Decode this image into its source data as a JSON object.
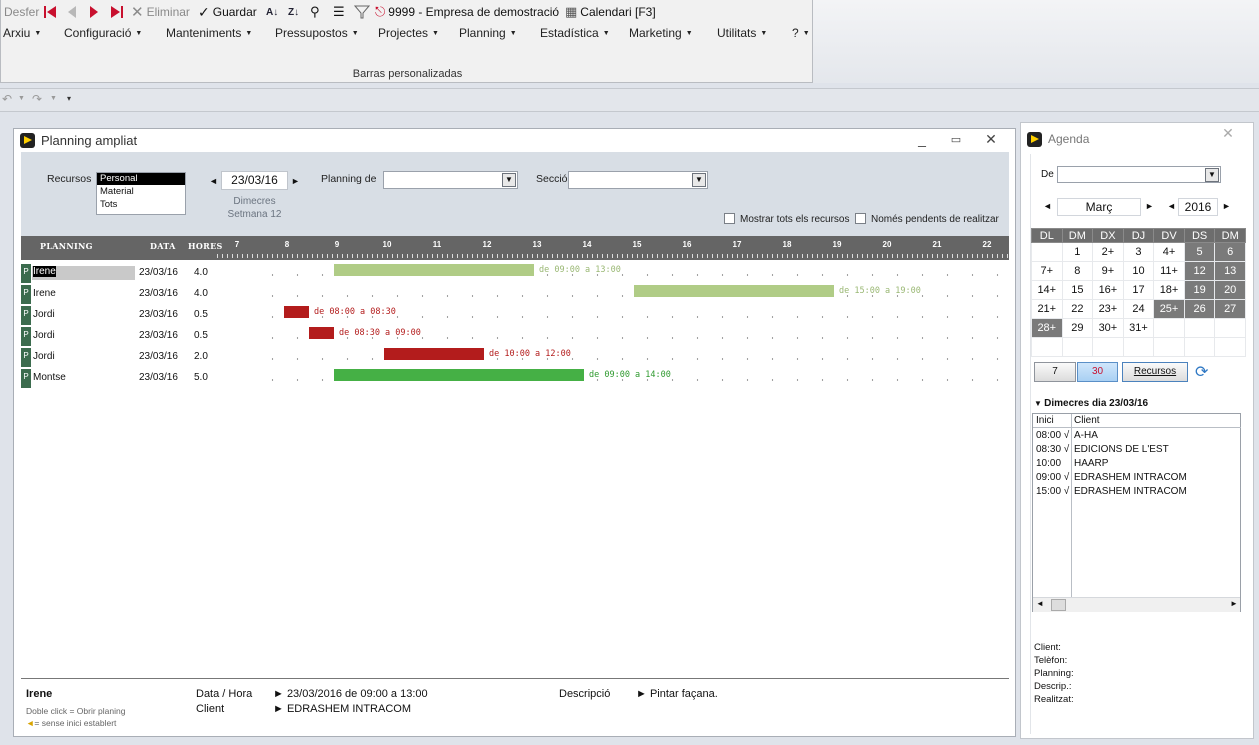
{
  "toolbar": {
    "undo": "Desfer",
    "delete": "Eliminar",
    "save": "Guardar",
    "company": "9999 - Empresa de demostració",
    "calendar": "Calendari [F3]"
  },
  "menu": [
    "Arxiu",
    "Configuració",
    "Manteniments",
    "Pressupostos",
    "Projectes",
    "Planning",
    "Estadística",
    "Marketing",
    "Utilitats",
    "?"
  ],
  "ribbon_group": "Barras personalizadas",
  "planning_window": {
    "title": "Planning ampliat",
    "recursos_label": "Recursos",
    "recursos_options": [
      "Personal",
      "Material",
      "Tots"
    ],
    "date": "23/03/16",
    "day_name": "Dimecres",
    "week": "Setmana 12",
    "planning_de_label": "Planning de",
    "seccio_label": "Secció",
    "chk_all": "Mostrar tots els recursos",
    "chk_pending": "Només pendents de realitzar",
    "columns": {
      "planning": "PLANNING",
      "data": "DATA",
      "hores": "HORES"
    },
    "hours": [
      "7",
      "8",
      "9",
      "10",
      "11",
      "12",
      "13",
      "14",
      "15",
      "16",
      "17",
      "18",
      "19",
      "20",
      "21",
      "22"
    ],
    "rows": [
      {
        "p": "P",
        "name": "Irene",
        "date": "23/03/16",
        "hours": "4.0",
        "start": 9,
        "end": 13,
        "label": "de 09:00 a 13:00",
        "color": "#b0cc86",
        "label_color": "#9ab874"
      },
      {
        "p": "P",
        "name": "Irene",
        "date": "23/03/16",
        "hours": "4.0",
        "start": 15,
        "end": 19,
        "label": "de 15:00 a 19:00",
        "color": "#b0cc86",
        "label_color": "#9ab874"
      },
      {
        "p": "P",
        "name": "Jordi",
        "date": "23/03/16",
        "hours": "0.5",
        "start": 8,
        "end": 8.5,
        "label": "de 08:00 a 08:30",
        "color": "#b31c1c",
        "label_color": "#b31c1c"
      },
      {
        "p": "P",
        "name": "Jordi",
        "date": "23/03/16",
        "hours": "0.5",
        "start": 8.5,
        "end": 9,
        "label": "de 08:30 a 09:00",
        "color": "#b31c1c",
        "label_color": "#b31c1c"
      },
      {
        "p": "P",
        "name": "Jordi",
        "date": "23/03/16",
        "hours": "2.0",
        "start": 10,
        "end": 12,
        "label": "de 10:00 a 12:00",
        "color": "#b31c1c",
        "label_color": "#b31c1c"
      },
      {
        "p": "P",
        "name": "Montse",
        "date": "23/03/16",
        "hours": "5.0",
        "start": 9,
        "end": 14,
        "label": "de 09:00 a 14:00",
        "color": "#45b045",
        "label_color": "#2f9a2f"
      }
    ],
    "status": {
      "name": "Irene",
      "hint1": "Doble click = Obrir planing",
      "hint2": "= sense inici establert",
      "date_label": "Data / Hora",
      "date_value": "► 23/03/2016  de 09:00 a 13:00",
      "client_label": "Client",
      "client_value": "► EDRASHEM INTRACOM",
      "desc_label": "Descripció",
      "desc_value": "► Pintar façana."
    }
  },
  "agenda": {
    "title": "Agenda",
    "de_label": "De",
    "month": "Març",
    "year": "2016",
    "weekdays": [
      "DL",
      "DM",
      "DX",
      "DJ",
      "DV",
      "DS",
      "DM"
    ],
    "weeks": [
      [
        "",
        "1",
        "2+",
        "3",
        "4+",
        "5",
        "6"
      ],
      [
        "7+",
        "8",
        "9+",
        "10",
        "11+",
        "12",
        "13"
      ],
      [
        "14+",
        "15",
        "16+",
        "17",
        "18+",
        "19",
        "20"
      ],
      [
        "21+",
        "22",
        "23+",
        "24",
        "25+",
        "26",
        "27"
      ],
      [
        "28+",
        "29",
        "30+",
        "31+",
        "",
        "",
        ""
      ],
      [
        "",
        "",
        "",
        "",
        "",
        "",
        ""
      ]
    ],
    "btn7": "7",
    "btn30": "30",
    "btn_recursos": "Recursos",
    "day_header": "Dimecres dia 23/03/16",
    "col_inici": "Inici",
    "col_client": "Client",
    "appointments": [
      {
        "time": "08:00 √",
        "client": "A-HA"
      },
      {
        "time": "08:30 √",
        "client": "EDICIONS DE L'EST"
      },
      {
        "time": "10:00",
        "client": "HAARP"
      },
      {
        "time": "09:00 √",
        "client": "EDRASHEM INTRACOM"
      },
      {
        "time": "15:00 √",
        "client": "EDRASHEM INTRACOM"
      }
    ],
    "info": [
      "Client:",
      "Telèfon:",
      "Planning:",
      "Descrip.:",
      "Realitzat:"
    ]
  }
}
